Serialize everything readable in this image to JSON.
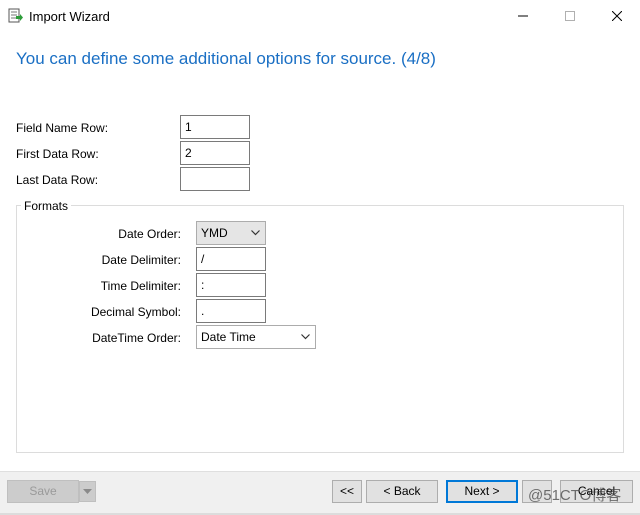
{
  "window": {
    "title": "Import Wizard",
    "icon": "import-wizard-icon"
  },
  "heading": "You can define some additional options for source. (4/8)",
  "fields": {
    "field_name_row": {
      "label": "Field Name Row:",
      "value": "1"
    },
    "first_data_row": {
      "label": "First Data Row:",
      "value": "2"
    },
    "last_data_row": {
      "label": "Last Data Row:",
      "value": ""
    }
  },
  "formats": {
    "legend": "Formats",
    "date_order": {
      "label": "Date Order:",
      "value": "YMD"
    },
    "date_delimiter": {
      "label": "Date Delimiter:",
      "value": "/"
    },
    "time_delimiter": {
      "label": "Time Delimiter:",
      "value": ":"
    },
    "decimal_symbol": {
      "label": "Decimal Symbol:",
      "value": "."
    },
    "datetime_order": {
      "label": "DateTime Order:",
      "value": "Date Time"
    }
  },
  "buttons": {
    "save": "Save",
    "first": "<<",
    "back": "< Back",
    "next": "Next >",
    "cancel": "Cancel"
  },
  "watermark": "@51CTO博客",
  "colors": {
    "heading": "#1a6fc4",
    "primary_border": "#0078d7"
  }
}
